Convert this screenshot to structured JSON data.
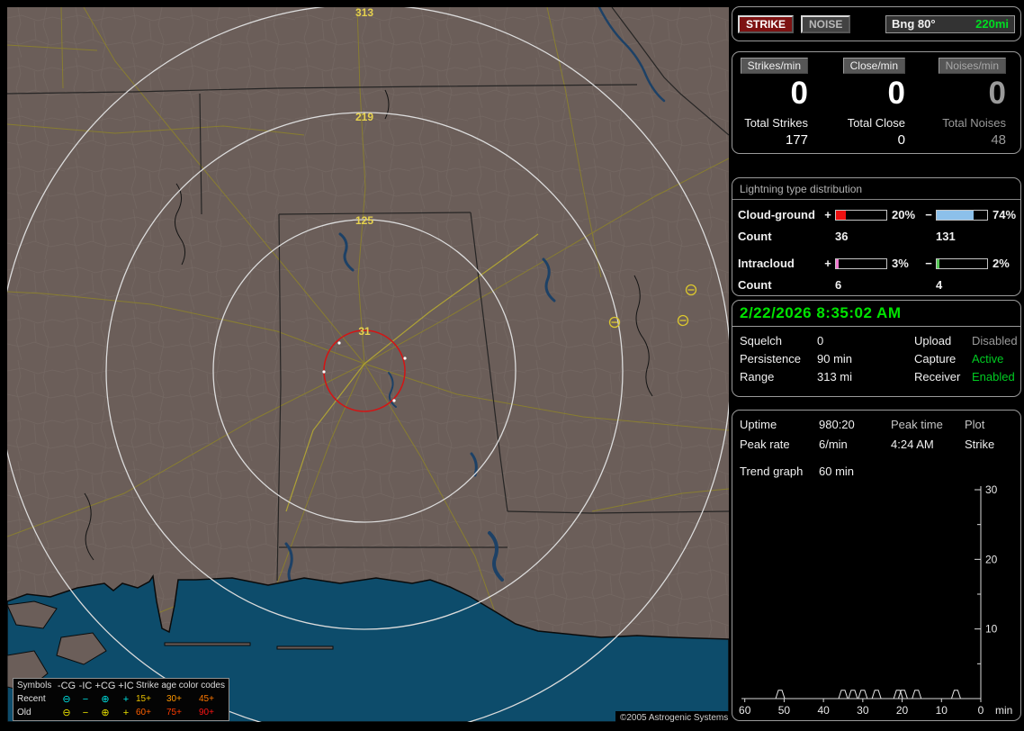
{
  "header": {
    "strike_label": "STRIKE",
    "noise_label": "NOISE",
    "bearing": "Bng 80°",
    "distance": "220mi",
    "distance_color": "#00dd22"
  },
  "counters": {
    "columns": [
      {
        "header": "Strikes/min",
        "rate": "0",
        "total_label": "Total Strikes",
        "total": "177",
        "dimmed": false
      },
      {
        "header": "Close/min",
        "rate": "0",
        "total_label": "Total Close",
        "total": "0",
        "dimmed": false
      },
      {
        "header": "Noises/min",
        "rate": "0",
        "total_label": "Total Noises",
        "total": "48",
        "dimmed": true
      }
    ]
  },
  "distribution": {
    "title": "Lightning type distribution",
    "plus_sign": "+",
    "minus_sign": "−",
    "count_label": "Count",
    "groups": [
      {
        "label": "Cloud-ground",
        "plus": {
          "pct": "20%",
          "fill": 20,
          "color": "#ee1111",
          "count": "36"
        },
        "minus": {
          "pct": "74%",
          "fill": 74,
          "color": "#8cc0ea",
          "count": "131"
        }
      },
      {
        "label": "Intracloud",
        "plus": {
          "pct": "3%",
          "fill": 6,
          "color": "#f07ad0",
          "count": "6"
        },
        "minus": {
          "pct": "2%",
          "fill": 5,
          "color": "#58c858",
          "count": "4"
        }
      }
    ]
  },
  "status": {
    "datetime": "2/22/2026 8:35:02 AM",
    "datetime_color": "#00e400",
    "rows": [
      {
        "l1": "Squelch",
        "v1": "0",
        "l2": "Upload",
        "v2": "Disabled"
      },
      {
        "l1": "Persistence",
        "v1": "90 min",
        "l2": "Capture",
        "v2": "Active"
      },
      {
        "l1": "Range",
        "v1": "313 mi",
        "l2": "Receiver",
        "v2": "Enabled"
      }
    ]
  },
  "stats": {
    "col3_header": "Peak time",
    "col4_header": "Plot",
    "rows": [
      {
        "label": "Uptime",
        "value": "980:20",
        "c3": "",
        "c4": ""
      },
      {
        "label": "Peak rate",
        "value": "6/min",
        "c3": "4:24 AM",
        "c4": "Strike"
      }
    ],
    "trend_label": "Trend graph",
    "trend_value": "60 min"
  },
  "trend_graph": {
    "type": "event-histogram",
    "y_max": 30,
    "y_ticks": [
      "30",
      "20",
      "10"
    ],
    "y_minor": [
      25,
      15,
      5
    ],
    "x_ticks": [
      "60",
      "50",
      "40",
      "30",
      "20",
      "10",
      "0"
    ],
    "x_max_min": 60,
    "x_unit": "min",
    "events_min_ago": [
      51,
      35,
      32.5,
      30,
      26.5,
      21,
      19.8,
      16.3,
      6.3
    ],
    "event_height_units": 1.2
  },
  "map": {
    "rings": [
      {
        "label": "313"
      },
      {
        "label": "219"
      },
      {
        "label": "125"
      },
      {
        "label": "31"
      }
    ],
    "ring_color": "#dcdcdc",
    "close_ring_color": "#d41414",
    "strike_symbol_count": 3,
    "copyright": "©2005 Astrogenic Systems"
  },
  "legend": {
    "symbols_header": "Symbols",
    "type_headers": [
      "-CG",
      "-IC",
      "+CG",
      "+IC"
    ],
    "age_header": "Strike age color codes",
    "symbols": [
      "⊖",
      "−",
      "⊕",
      "+"
    ],
    "rows": [
      {
        "label": "Recent",
        "color": "#00e0e0",
        "ages": [
          {
            "t": "15+",
            "c": "#e8c000"
          },
          {
            "t": "30+",
            "c": "#ff9800"
          },
          {
            "t": "45+",
            "c": "#ff7800"
          }
        ]
      },
      {
        "label": "Old",
        "color": "#e8e000",
        "ages": [
          {
            "t": "60+",
            "c": "#ff6000"
          },
          {
            "t": "75+",
            "c": "#ff3c00"
          },
          {
            "t": "90+",
            "c": "#ff1414"
          }
        ]
      }
    ]
  }
}
